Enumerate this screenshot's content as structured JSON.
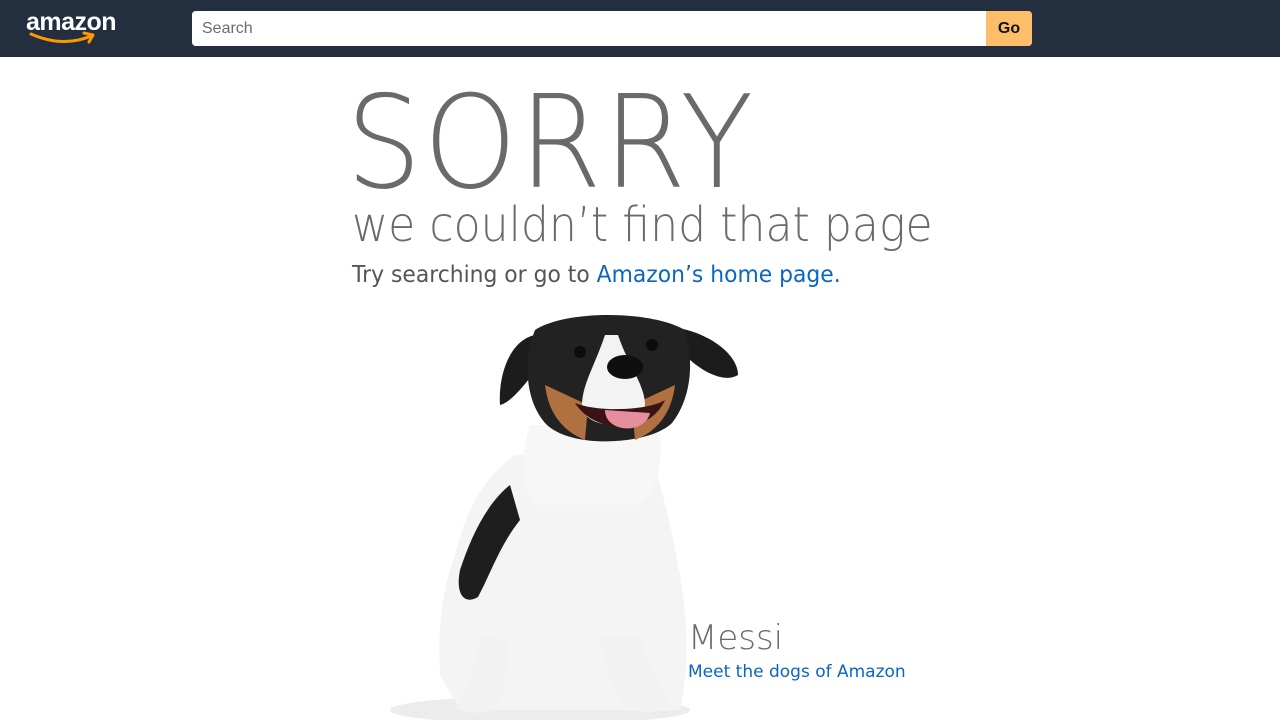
{
  "header": {
    "logo_text": "amazon",
    "search": {
      "placeholder": "Search",
      "value": ""
    },
    "go_label": "Go",
    "colors": {
      "bar": "#232f3e",
      "go_button": "#febd69",
      "smile": "#ff9900"
    }
  },
  "main": {
    "headline": "SORRY",
    "subheadline": "we couldn’t find that page",
    "try_prefix": "Try searching or go to ",
    "home_link_label": "Amazon’s home page",
    "try_suffix": ".",
    "dog": {
      "name": "Messi",
      "link_label": "Meet the dogs of Amazon"
    },
    "colors": {
      "text": "#6a6a6a",
      "link": "#0a66c2"
    }
  }
}
